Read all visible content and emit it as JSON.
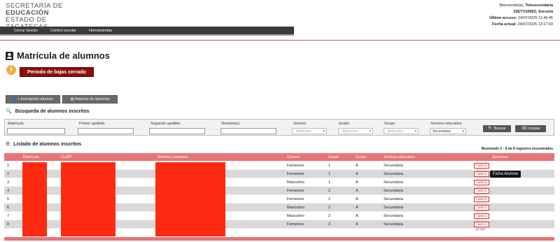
{
  "logo": {
    "line1": "SECRETARÍA DE",
    "line2": "EDUCACIÓN",
    "line3": "ESTADO DE ZACATECAS"
  },
  "user": {
    "greeting": "Bienvenido(a),",
    "name": "Telesecundaria",
    "school": "32ETV1066Z; Escuela",
    "last_access_label": "Último acceso:",
    "last_access": "24/07/2025 11:46:45",
    "current_date_label": "Fecha actual:",
    "current_date": "24/07/2025 13:17:03"
  },
  "nav": {
    "items": [
      "Cerrar Sesión",
      "Control escolar",
      "Herramientas"
    ]
  },
  "page": {
    "title": "Matrícula de alumnos",
    "notice": "Periodo de bajas cerrado"
  },
  "buttons": {
    "inscripcion": "Inscripción alumno",
    "reporte": "Reporte de alumnos"
  },
  "search": {
    "section_title": "Búsqueda de alumnos inscritos",
    "fields": {
      "matricula": "Matrícula",
      "primer_apellido": "Primer apellido",
      "segundo_apellido": "Segundo apellido",
      "nombre": "Nombre(s)",
      "genero": "Género",
      "grado": "Grado",
      "grupo": "Grupo",
      "servicio": "Servicio educativo"
    },
    "placeholders": {
      "genero": "-Seleccion...",
      "grado": "-Seleccion...",
      "grupo": "-Seleccion..."
    },
    "servicio_value": "Secundaria",
    "btn_search": "Buscar",
    "btn_clear": "Limpiar"
  },
  "list": {
    "section_title": "Listado de alumnos inscritos",
    "showing": "Mostrando 1 - 8 de 8 registros encontrados",
    "columns": [
      "Matrícula",
      "CURP",
      "Nombre completo",
      "Género",
      "Grado",
      "Grupo",
      "Servicio educativo",
      "Opciones"
    ],
    "rows": [
      {
        "n": "1",
        "genero": "Femenino",
        "grado": "1",
        "grupo": "A",
        "servicio": "Secundaria"
      },
      {
        "n": "2",
        "genero": "Femenino",
        "grado": "1",
        "grupo": "A",
        "servicio": "Secundaria"
      },
      {
        "n": "3",
        "genero": "Masculino",
        "grado": "1",
        "grupo": "A",
        "servicio": "Secundaria"
      },
      {
        "n": "4",
        "genero": "Femenino",
        "grado": "2",
        "grupo": "A",
        "servicio": "Secundaria"
      },
      {
        "n": "5",
        "genero": "Femenino",
        "grado": "2",
        "grupo": "A",
        "servicio": "Secundaria"
      },
      {
        "n": "6",
        "genero": "Masculino",
        "grado": "2",
        "grupo": "A",
        "servicio": "Secundaria"
      },
      {
        "n": "7",
        "genero": "Masculino",
        "grado": "2",
        "grupo": "A",
        "servicio": "Secundaria"
      },
      {
        "n": "8",
        "genero": "Femenino",
        "grado": "3",
        "grupo": "A",
        "servicio": "Secundaria"
      }
    ],
    "ficha": "Ficha",
    "cambio": "Cambio grupo",
    "tooltip": "Ficha Alumno"
  }
}
